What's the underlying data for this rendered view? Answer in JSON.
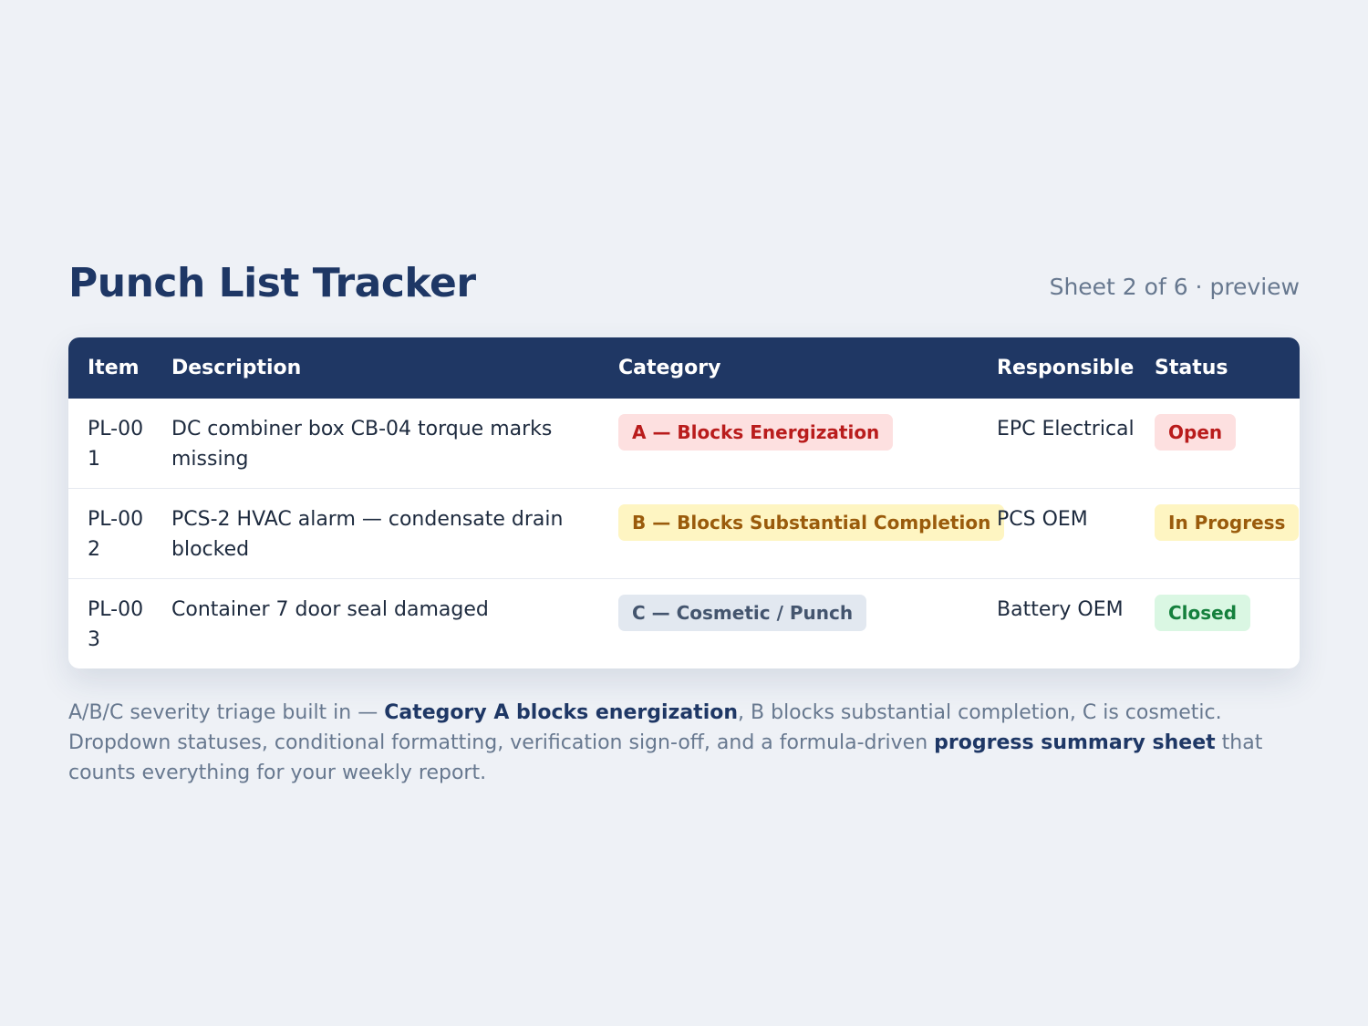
{
  "header": {
    "title": "Punch List Tracker",
    "sheet_note": "Sheet 2 of 6 · preview"
  },
  "table": {
    "columns": [
      "Item",
      "Description",
      "Category",
      "Responsible",
      "Status"
    ],
    "rows": [
      {
        "item": "PL-001",
        "description": "DC combiner box CB-04 torque marks missing",
        "category": "A — Blocks Energization",
        "responsible": "EPC Electrical",
        "status": "Open"
      },
      {
        "item": "PL-002",
        "description": "PCS-2 HVAC alarm — condensate drain blocked",
        "category": "B — Blocks Substantial Completion",
        "responsible": "PCS OEM",
        "status": "In Progress"
      },
      {
        "item": "PL-003",
        "description": "Container 7 door seal damaged",
        "category": "C — Cosmetic / Punch",
        "responsible": "Battery OEM",
        "status": "Closed"
      }
    ]
  },
  "footnote": {
    "part1": "A/B/C severity triage built in — ",
    "bold1": "Category A blocks energization",
    "part2": ", B blocks substantial completion, C is cosmetic. Dropdown statuses, conditional formatting, verification sign-off, and a formula-driven ",
    "bold2": "progress summary sheet",
    "part3": " that counts everything for your weekly report."
  },
  "colors": {
    "background": "#eef1f6",
    "header_navy": "#1f3764",
    "category_a": "#b91c1c",
    "category_b": "#9a5b0c",
    "category_c": "#44556e",
    "status_closed": "#15803d"
  }
}
